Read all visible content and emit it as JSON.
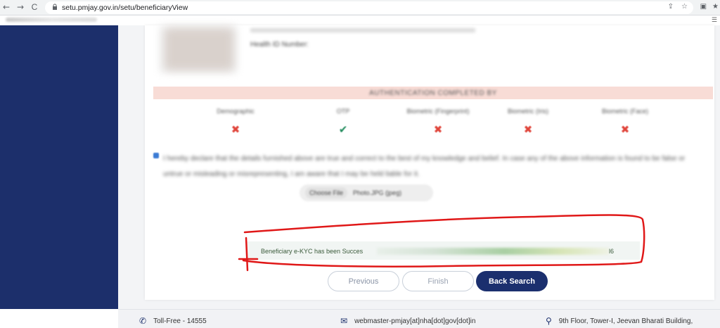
{
  "browser": {
    "url": "setu.pmjay.gov.in/setu/beneficiaryView",
    "back_glyph": "←",
    "forward_glyph": "→",
    "reload_glyph": "C"
  },
  "profile": {
    "health_label": "Health ID Number:"
  },
  "auth": {
    "status_text": "AUTHENTICATION COMPLETED BY"
  },
  "auth_modes": [
    {
      "label": "Demographic",
      "status": "fail",
      "glyph": "✖"
    },
    {
      "label": "OTP",
      "status": "success",
      "glyph": "✔"
    },
    {
      "label": "Biometric (Fingerprint)",
      "status": "fail",
      "glyph": "✖"
    },
    {
      "label": "Biometric (Iris)",
      "status": "fail",
      "glyph": "✖"
    },
    {
      "label": "Biometric (Face)",
      "status": "fail",
      "glyph": "✖"
    }
  ],
  "consent": {
    "text": "I hereby declare that the details furnished above are true and correct to the best of my knowledge and belief. In case any of the above information is found to be false or untrue or misleading or misrepresenting, I am aware that I may be held liable for it."
  },
  "file": {
    "choose_label": "Choose File",
    "file_name": "Photo.JPG (jpeg)"
  },
  "alert": {
    "message": "Beneficiary e-KYC has been Succes",
    "trailing": "l6"
  },
  "buttons": {
    "previous": "Previous",
    "finish": "Finish",
    "back_search": "Back Search"
  },
  "footer": {
    "toll_free": "Toll-Free - 14555",
    "email": "webmaster-pmjay[at]nha[dot]gov[dot]in",
    "address": "9th Floor, Tower-I, Jeevan Bharati Building,"
  },
  "colors": {
    "sidebar": "#1c2f6b",
    "primary_button": "#1b2f6e",
    "fail": "#e0443a",
    "success": "#1f8a5b",
    "annotation": "#e01818"
  }
}
